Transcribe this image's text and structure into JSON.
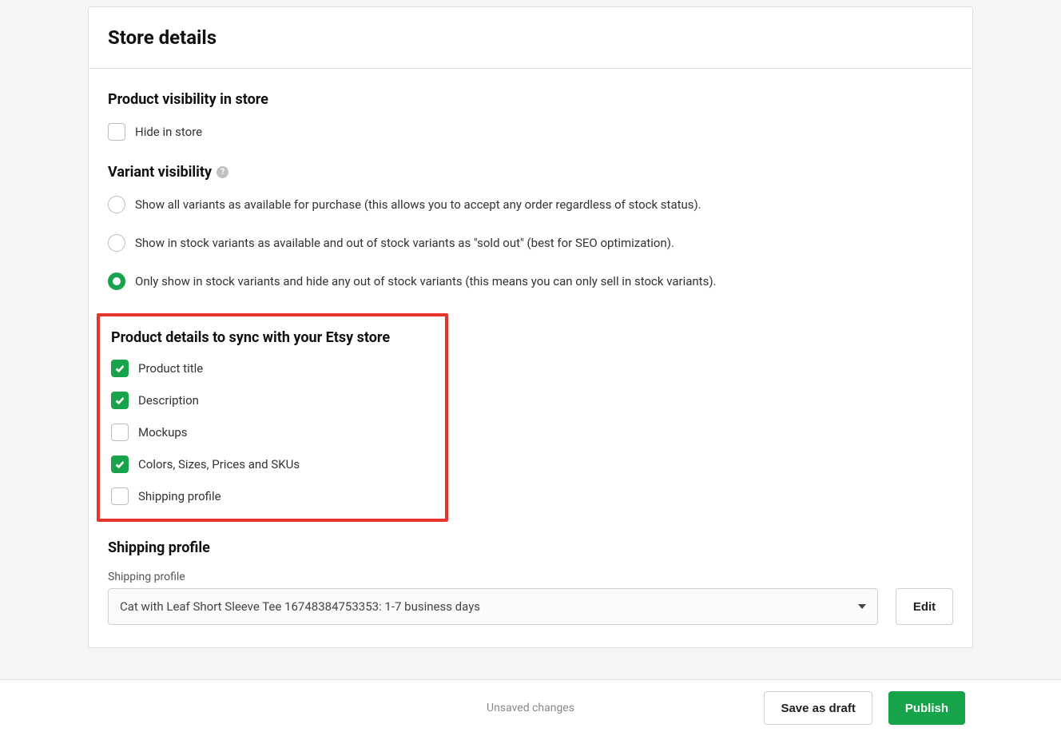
{
  "header": {
    "title": "Store details"
  },
  "visibility": {
    "title": "Product visibility in store",
    "hide_label": "Hide in store",
    "hide_checked": false
  },
  "variant_visibility": {
    "title": "Variant visibility",
    "options": [
      {
        "label": "Show all variants as available for purchase (this allows you to accept any order regardless of stock status).",
        "selected": false
      },
      {
        "label": "Show in stock variants as available and out of stock variants as \"sold out\" (best for SEO optimization).",
        "selected": false
      },
      {
        "label": "Only show in stock variants and hide any out of stock variants (this means you can only sell in stock variants).",
        "selected": true
      }
    ]
  },
  "sync": {
    "title": "Product details to sync with your Etsy store",
    "items": [
      {
        "label": "Product title",
        "checked": true
      },
      {
        "label": "Description",
        "checked": true
      },
      {
        "label": "Mockups",
        "checked": false
      },
      {
        "label": "Colors, Sizes, Prices and SKUs",
        "checked": true
      },
      {
        "label": "Shipping profile",
        "checked": false
      }
    ]
  },
  "shipping": {
    "title": "Shipping profile",
    "field_label": "Shipping profile",
    "selected": "Cat with Leaf Short Sleeve Tee 16748384753353: 1-7 business days",
    "edit_label": "Edit"
  },
  "footer": {
    "status": "Unsaved changes",
    "draft_label": "Save as draft",
    "publish_label": "Publish"
  }
}
